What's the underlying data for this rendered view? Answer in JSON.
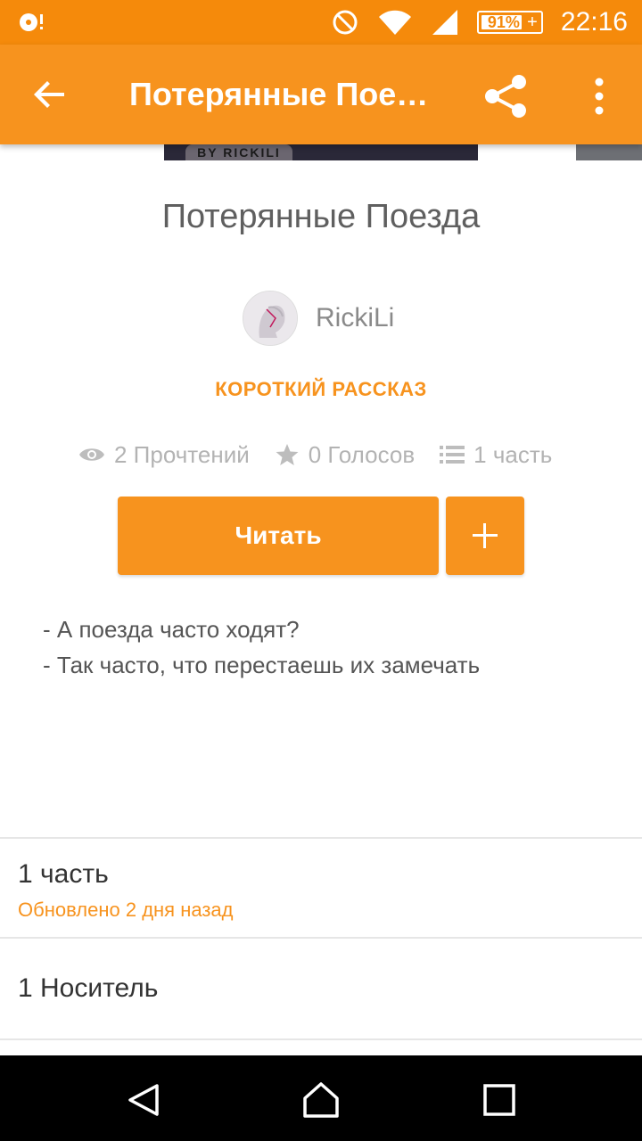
{
  "status_bar": {
    "notification_icon": "music-disc-icon",
    "battery_percent": "91%",
    "time": "22:16",
    "icons": [
      "do-not-disturb-icon",
      "wifi-icon",
      "signal-icon",
      "battery-charging-icon"
    ]
  },
  "app_bar": {
    "title": "Потерянные Пое…",
    "back_icon": "arrow-left-icon",
    "share_icon": "share-icon",
    "more_icon": "more-vert-icon"
  },
  "cover": {
    "caption": "BY RICKILI"
  },
  "story": {
    "title": "Потерянные Поезда",
    "author": "RickiLi",
    "category": "КОРОТКИЙ РАССКАЗ",
    "reads": "2 Прочтений",
    "votes": "0 Голосов",
    "parts": "1 часть",
    "read_button": "Читать",
    "add_button": "+",
    "description": [
      "- А поезда часто ходят?",
      "- Так часто, что перестаешь их замечать"
    ]
  },
  "rows": {
    "parts_title": "1 часть",
    "parts_updated": "Обновлено 2 дня назад",
    "lists_title": "1 Носитель"
  },
  "colors": {
    "status_bar": "#f58a0b",
    "accent": "#f7931e",
    "text_gray": "#5f5f5f"
  }
}
